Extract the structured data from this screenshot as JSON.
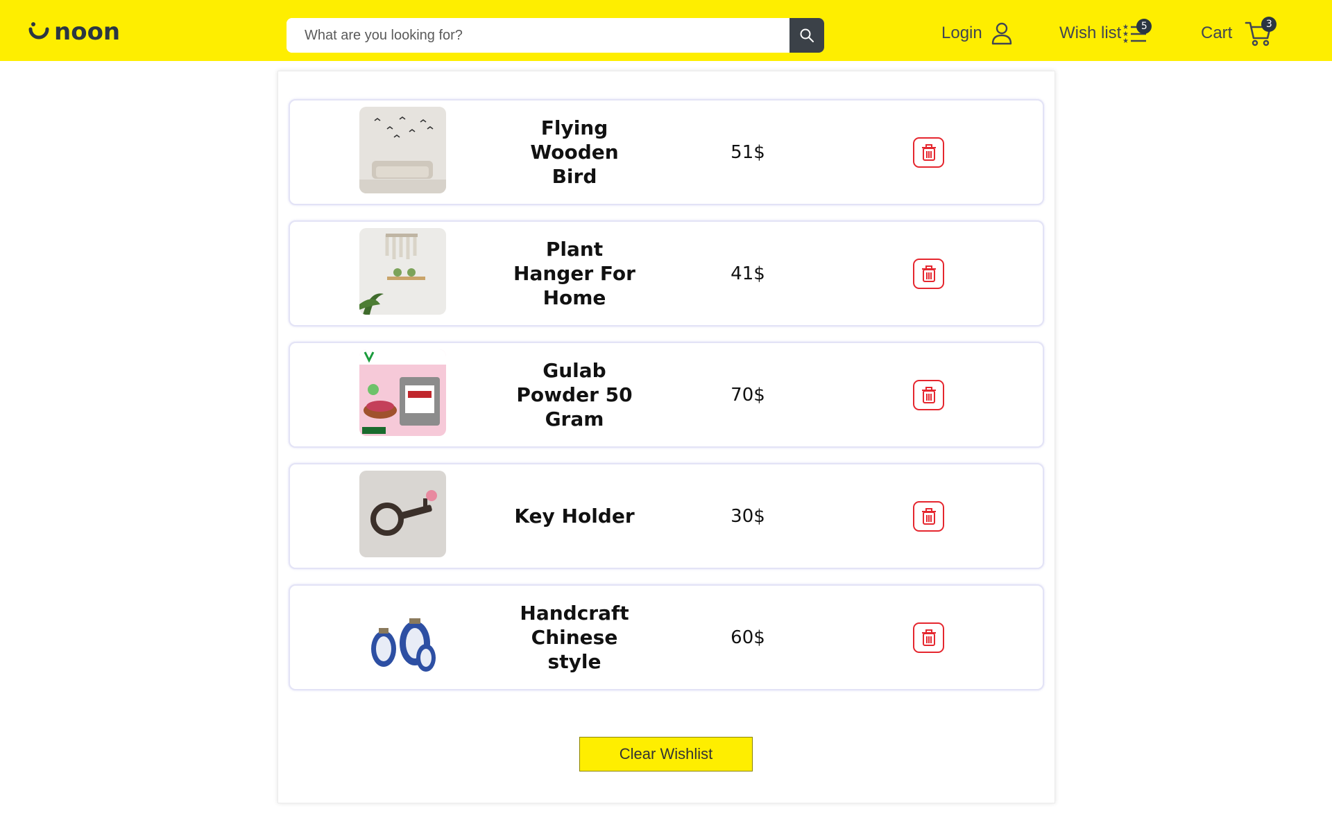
{
  "header": {
    "brand": "noon",
    "search_placeholder": "What are you looking for?",
    "login_label": "Login",
    "wishlist_label": "Wish list",
    "wishlist_count": "5",
    "cart_label": "Cart",
    "cart_count": "3",
    "accent": "#feee00"
  },
  "wishlist": {
    "items": [
      {
        "name": "Flying Wooden Bird",
        "price": "51$"
      },
      {
        "name": "Plant Hanger For Home",
        "price": "41$"
      },
      {
        "name": "Gulab Powder 50 Gram",
        "price": "70$"
      },
      {
        "name": "Key Holder",
        "price": "30$"
      },
      {
        "name": "Handcraft Chinese style",
        "price": "60$"
      }
    ],
    "clear_label": "Clear Wishlist",
    "delete_color": "#e5262e"
  }
}
